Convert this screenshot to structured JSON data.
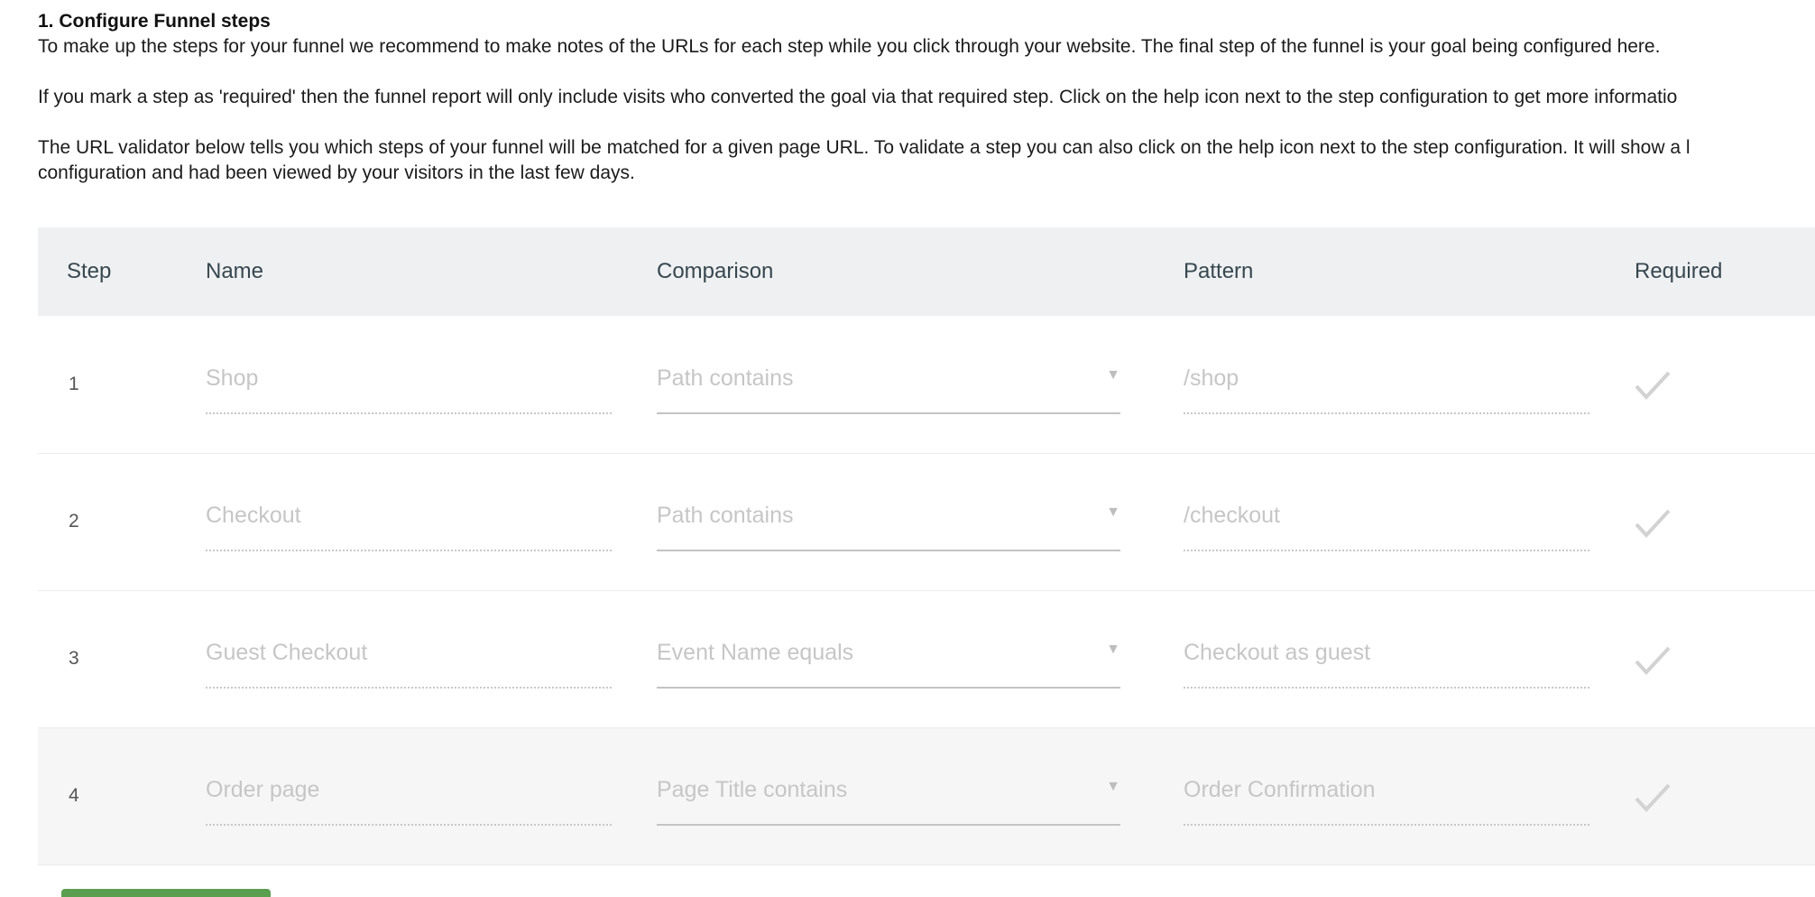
{
  "intro": {
    "heading": "1. Configure Funnel steps",
    "para1": "To make up the steps for your funnel we recommend to make notes of the URLs for each step while you click through your website. The final step of the funnel is your goal being configured here.",
    "para2": "If you mark a step as 'required' then the funnel report will only include visits who converted the goal via that required step. Click on the help icon next to the step configuration to get more informatio",
    "para3_line1": "The URL validator below tells you which steps of your funnel will be matched for a given page URL. To validate a step you can also click on the help icon next to the step configuration. It will show a l",
    "para3_line2": "configuration and had been viewed by your visitors in the last few days."
  },
  "table": {
    "headers": {
      "step": "Step",
      "name": "Name",
      "comparison": "Comparison",
      "pattern": "Pattern",
      "required": "Required"
    },
    "rows": [
      {
        "step": "1",
        "name": "Shop",
        "comparison": "Path contains",
        "pattern": "/shop"
      },
      {
        "step": "2",
        "name": "Checkout",
        "comparison": "Path contains",
        "pattern": "/checkout"
      },
      {
        "step": "3",
        "name": "Guest Checkout",
        "comparison": "Event Name equals",
        "pattern": "Checkout as guest"
      },
      {
        "step": "4",
        "name": "Order page",
        "comparison": "Page Title contains",
        "pattern": "Order Confirmation"
      }
    ]
  },
  "icons": {
    "required_check": "check-icon",
    "comparison_caret": "triangle-down-icon"
  },
  "colors": {
    "header_bg": "#eef0f2",
    "placeholder_text": "#c6c6c6",
    "button_green": "#5a9e4f"
  }
}
